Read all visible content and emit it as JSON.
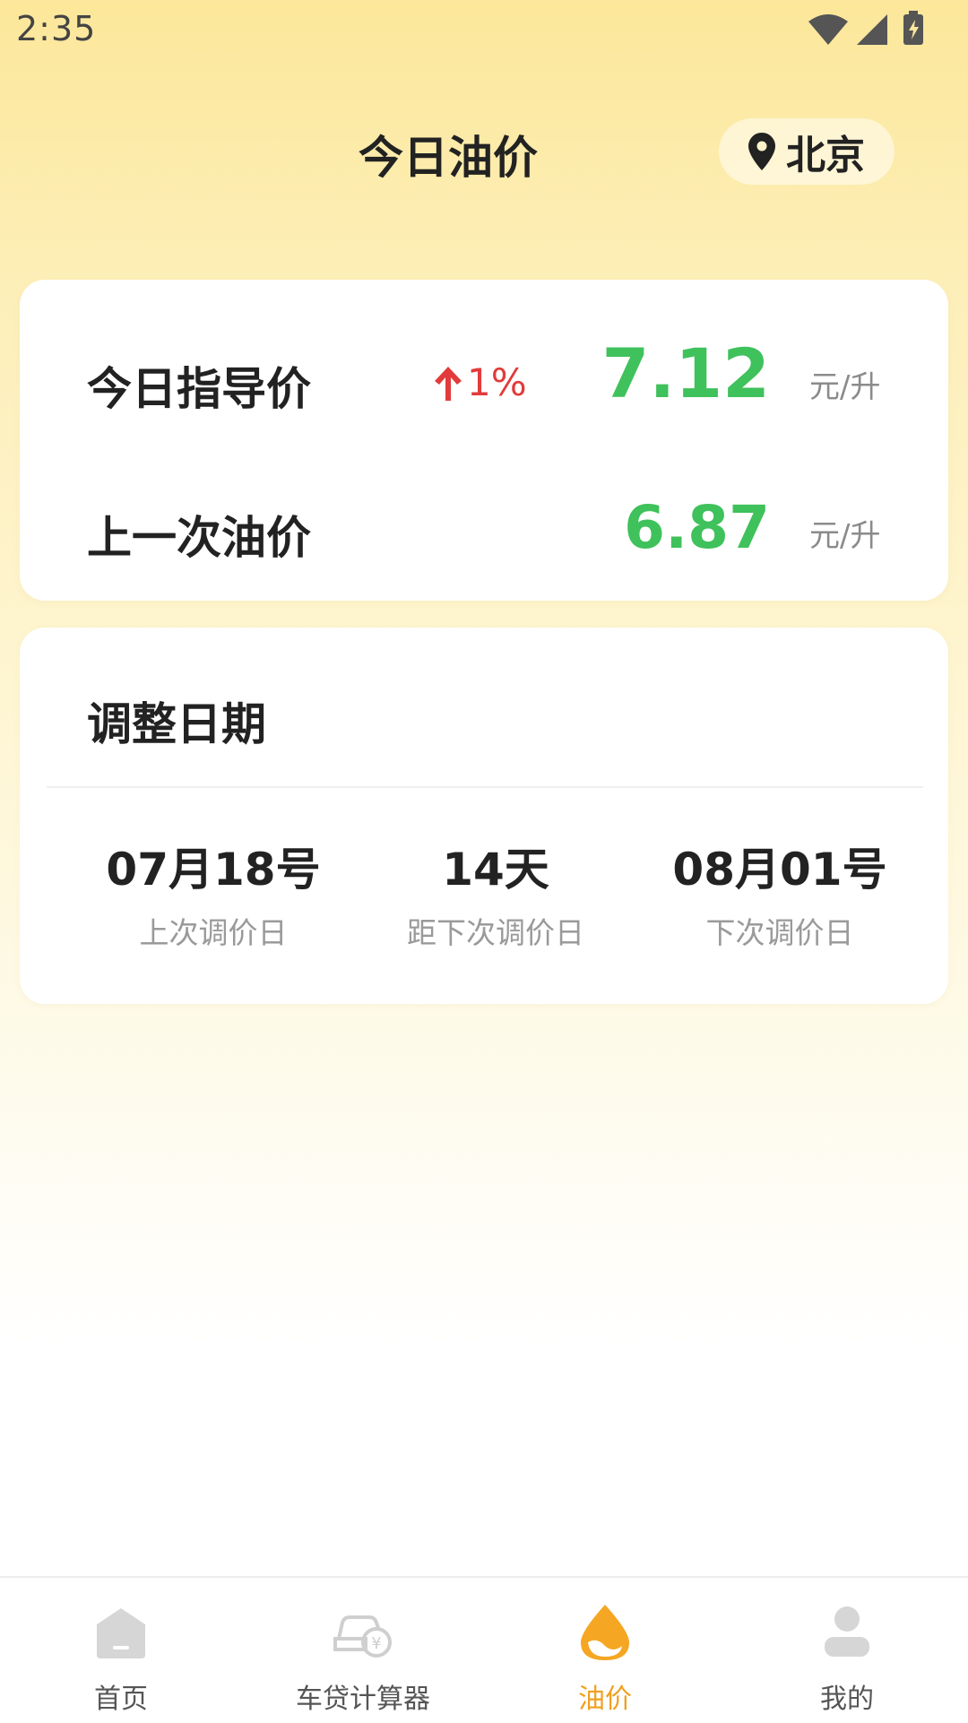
{
  "status_bar": {
    "time": "2:35"
  },
  "header": {
    "title": "今日油价",
    "location": "北京"
  },
  "prices": {
    "today": {
      "label": "今日指导价",
      "change": "1%",
      "value": "7.12",
      "unit": "元/升"
    },
    "last": {
      "label": "上一次油价",
      "value": "6.87",
      "unit": "元/升"
    }
  },
  "dates": {
    "title": "调整日期",
    "items": [
      {
        "value": "07月18号",
        "label": "上次调价日"
      },
      {
        "value": "14天",
        "label": "距下次调价日"
      },
      {
        "value": "08月01号",
        "label": "下次调价日"
      }
    ]
  },
  "nav": {
    "items": [
      {
        "label": "首页",
        "icon": "home-icon"
      },
      {
        "label": "车贷计算器",
        "icon": "car-loan-icon"
      },
      {
        "label": "油价",
        "icon": "oil-drop-icon"
      },
      {
        "label": "我的",
        "icon": "profile-icon"
      }
    ],
    "active_index": 2
  },
  "colors": {
    "accent": "#F0A020",
    "price_green": "#3FC15B",
    "rise_red": "#E23B3B"
  }
}
